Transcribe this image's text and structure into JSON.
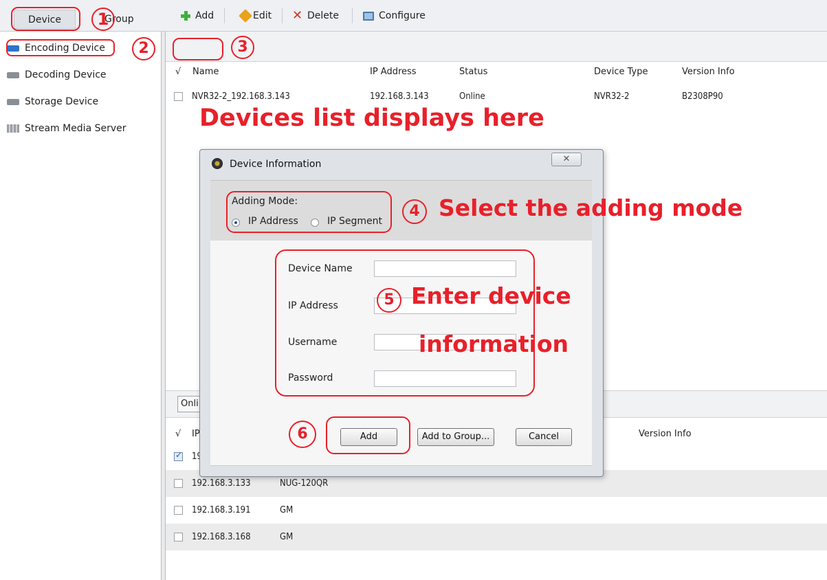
{
  "top_tabs": {
    "device": "Device",
    "group": "Group"
  },
  "sidebar": {
    "items": [
      {
        "label": "Encoding Device",
        "icon": "device-icon"
      },
      {
        "label": "Decoding Device",
        "icon": "device-icon"
      },
      {
        "label": "Storage Device",
        "icon": "device-icon"
      },
      {
        "label": "Stream Media Server",
        "icon": "server-icon"
      }
    ]
  },
  "toolbar": {
    "add": "Add",
    "edit": "Edit",
    "delete": "Delete",
    "configure": "Configure"
  },
  "device_table": {
    "check_col": "√",
    "columns": [
      "Name",
      "IP Address",
      "Status",
      "Device Type",
      "Version Info"
    ],
    "rows": [
      {
        "name": "NVR32-2_192.168.3.143",
        "ip": "192.168.3.143",
        "status": "Online",
        "type": "NVR32-2",
        "version": "B2308P90"
      }
    ]
  },
  "online_button": "Onli",
  "online_table": {
    "check_col": "√",
    "col_ip": "IP",
    "col_version": "Version Info",
    "rows": [
      {
        "ip": "19",
        "type": "",
        "checked": true
      },
      {
        "ip": "192.168.3.133",
        "type": "NUG-120QR",
        "checked": false
      },
      {
        "ip": "192.168.3.191",
        "type": "GM",
        "checked": false
      },
      {
        "ip": "192.168.3.168",
        "type": "GM",
        "checked": false
      }
    ]
  },
  "dialog": {
    "title": "Device Information",
    "close": "✕",
    "adding_mode_label": "Adding Mode:",
    "mode_ip_address": "IP Address",
    "mode_ip_segment": "IP Segment",
    "selected_mode": "IP Address",
    "fields": {
      "device_name": {
        "label": "Device Name",
        "value": ""
      },
      "ip_address": {
        "label": "IP Address",
        "value": ""
      },
      "username": {
        "label": "Username",
        "value": ""
      },
      "password": {
        "label": "Password",
        "value": ""
      }
    },
    "buttons": {
      "add": "Add",
      "add_to_group": "Add to Group...",
      "cancel": "Cancel"
    }
  },
  "annotations": {
    "n1": "1",
    "n2": "2",
    "n3": "3",
    "n4": "4",
    "n5": "5",
    "n6": "6",
    "devices_list": "Devices list displays here",
    "select_mode": "Select the adding mode",
    "enter_info_1": "Enter device",
    "enter_info_2": "information",
    "color": "#e8202a"
  }
}
